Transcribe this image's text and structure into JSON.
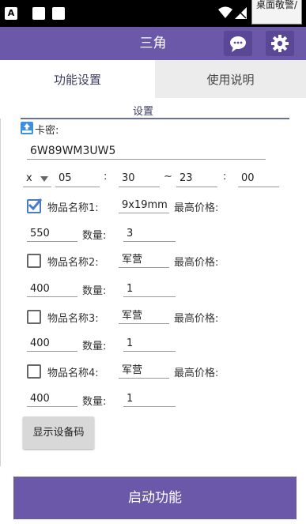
{
  "status_bar": {
    "notif_a": "A",
    "tooltip": "桌面敬警/",
    "icons": [
      "wifi-icon",
      "signal-icon"
    ]
  },
  "app_bar": {
    "title": "三角",
    "icons": [
      "chat-icon",
      "gear-icon"
    ]
  },
  "tabs": [
    {
      "label": "功能设置",
      "selected": true
    },
    {
      "label": "使用说明",
      "selected": false
    }
  ],
  "section_title": "设置",
  "card": {
    "label": "卡密:",
    "value": "6W89WM3UW5",
    "icon": "top-icon"
  },
  "time": {
    "day": "x",
    "start_hour": "05",
    "sep1": ":",
    "start_min": "30",
    "tilde": "~",
    "end_hour": "23",
    "sep2": ":",
    "end_min": "00"
  },
  "items": [
    {
      "label": "物品名称1:",
      "name": "9x19mm",
      "price_label": "最高价格:",
      "price": "550",
      "qty_label": "数量:",
      "qty": "3",
      "checked": true
    },
    {
      "label": "物品名称2:",
      "name": "军营",
      "price_label": "最高价格:",
      "price": "400",
      "qty_label": "数量:",
      "qty": "1",
      "checked": false
    },
    {
      "label": "物品名称3:",
      "name": "军营",
      "price_label": "最高价格:",
      "price": "400",
      "qty_label": "数量:",
      "qty": "1",
      "checked": false
    },
    {
      "label": "物品名称4:",
      "name": "军营",
      "price_label": "最高价格:",
      "price": "400",
      "qty_label": "数量:",
      "qty": "1",
      "checked": false
    }
  ],
  "device_button": "显示设备码",
  "start_button": "启动功能",
  "colors": {
    "accent": "#6b58a8",
    "checkbox": "#4a7bc8"
  }
}
